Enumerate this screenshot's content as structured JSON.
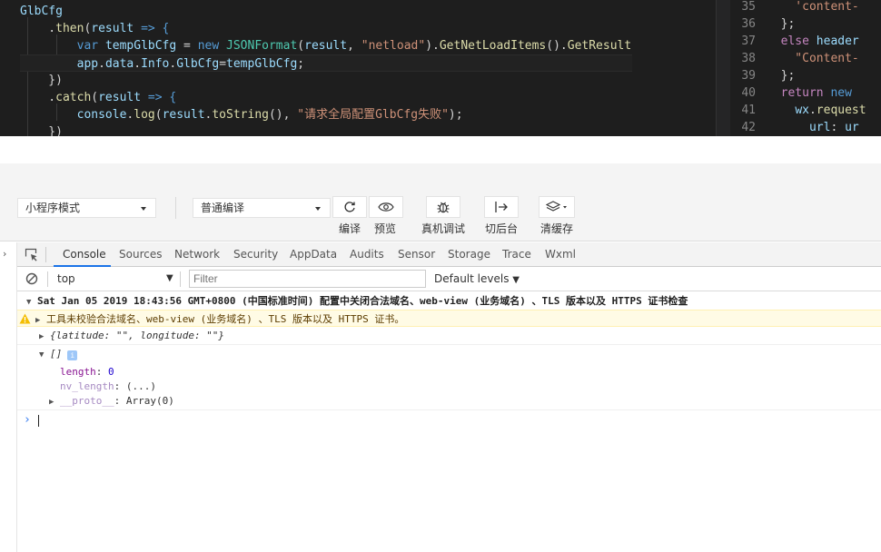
{
  "editor_left": {
    "lines": [
      [
        {
          "t": "GlbCfg",
          "c": "pl9"
        }
      ],
      [
        {
          "t": "    .",
          "c": "plain"
        },
        {
          "t": "then",
          "c": "fn"
        },
        {
          "t": "(",
          "c": "plain"
        },
        {
          "t": "result",
          "c": "var"
        },
        {
          "t": " => {",
          "c": "kw"
        }
      ],
      [
        {
          "t": "        ",
          "c": "plain"
        },
        {
          "t": "var",
          "c": "kw"
        },
        {
          "t": " ",
          "c": "plain"
        },
        {
          "t": "tempGlbCfg",
          "c": "var"
        },
        {
          "t": " = ",
          "c": "plain"
        },
        {
          "t": "new",
          "c": "kw"
        },
        {
          "t": " ",
          "c": "plain"
        },
        {
          "t": "JSONFormat",
          "c": "cls"
        },
        {
          "t": "(",
          "c": "plain"
        },
        {
          "t": "result",
          "c": "var"
        },
        {
          "t": ", ",
          "c": "plain"
        },
        {
          "t": "\"netload\"",
          "c": "str"
        },
        {
          "t": ").",
          "c": "plain"
        },
        {
          "t": "GetNetLoadItems",
          "c": "fn"
        },
        {
          "t": "().",
          "c": "plain"
        },
        {
          "t": "GetResults",
          "c": "fn"
        },
        {
          "t": "(",
          "c": "plain"
        }
      ],
      [
        {
          "t": "        ",
          "c": "plain"
        },
        {
          "t": "app",
          "c": "var"
        },
        {
          "t": ".",
          "c": "plain"
        },
        {
          "t": "data",
          "c": "var"
        },
        {
          "t": ".",
          "c": "plain"
        },
        {
          "t": "Info",
          "c": "var"
        },
        {
          "t": ".",
          "c": "plain"
        },
        {
          "t": "GlbCfg",
          "c": "var"
        },
        {
          "t": "=",
          "c": "plain"
        },
        {
          "t": "tempGlbCfg",
          "c": "var"
        },
        {
          "t": ";",
          "c": "plain"
        }
      ],
      [
        {
          "t": "    })",
          "c": "plain"
        }
      ],
      [
        {
          "t": "    .",
          "c": "plain"
        },
        {
          "t": "catch",
          "c": "fn"
        },
        {
          "t": "(",
          "c": "plain"
        },
        {
          "t": "result",
          "c": "var"
        },
        {
          "t": " => {",
          "c": "kw"
        }
      ],
      [
        {
          "t": "        ",
          "c": "plain"
        },
        {
          "t": "console",
          "c": "var"
        },
        {
          "t": ".",
          "c": "plain"
        },
        {
          "t": "log",
          "c": "fn"
        },
        {
          "t": "(",
          "c": "plain"
        },
        {
          "t": "result",
          "c": "var"
        },
        {
          "t": ".",
          "c": "plain"
        },
        {
          "t": "toString",
          "c": "fn"
        },
        {
          "t": "(), ",
          "c": "plain"
        },
        {
          "t": "\"请求全局配置GlbCfg失败\"",
          "c": "str"
        },
        {
          "t": ");",
          "c": "plain"
        }
      ],
      [
        {
          "t": "    })",
          "c": "plain"
        }
      ]
    ]
  },
  "editor_right": {
    "rows": [
      {
        "num": "35",
        "parts": [
          {
            "t": "    'content-",
            "c": "str"
          }
        ]
      },
      {
        "num": "36",
        "parts": [
          {
            "t": "  };",
            "c": "plain"
          }
        ]
      },
      {
        "num": "37",
        "parts": [
          {
            "t": "  ",
            "c": "plain"
          },
          {
            "t": "else",
            "c": "kw2"
          },
          {
            "t": " header",
            "c": "var"
          }
        ]
      },
      {
        "num": "38",
        "parts": [
          {
            "t": "    \"Content-",
            "c": "str"
          }
        ]
      },
      {
        "num": "39",
        "parts": [
          {
            "t": "  };",
            "c": "plain"
          }
        ]
      },
      {
        "num": "40",
        "parts": [
          {
            "t": "  ",
            "c": "plain"
          },
          {
            "t": "return",
            "c": "kw2"
          },
          {
            "t": " ",
            "c": "plain"
          },
          {
            "t": "new",
            "c": "kw"
          }
        ]
      },
      {
        "num": "41",
        "parts": [
          {
            "t": "    ",
            "c": "plain"
          },
          {
            "t": "wx",
            "c": "var"
          },
          {
            "t": ".",
            "c": "plain"
          },
          {
            "t": "request",
            "c": "fn"
          }
        ]
      },
      {
        "num": "42",
        "parts": [
          {
            "t": "      ",
            "c": "plain"
          },
          {
            "t": "url",
            "c": "var"
          },
          {
            "t": ": ",
            "c": "plain"
          },
          {
            "t": "ur",
            "c": "var"
          }
        ]
      }
    ]
  },
  "toolbar": {
    "mode_select": "小程序模式",
    "compile_select": "普通编译",
    "buttons": [
      {
        "label": "编译",
        "icon": "refresh-icon"
      },
      {
        "label": "预览",
        "icon": "eye-icon"
      },
      {
        "label": "真机调试",
        "icon": "bug-icon"
      },
      {
        "label": "切后台",
        "icon": "switch-background-icon"
      },
      {
        "label": "清缓存",
        "icon": "layers-icon"
      }
    ]
  },
  "devtools": {
    "tabs": [
      "Console",
      "Sources",
      "Network",
      "Security",
      "AppData",
      "Audits",
      "Sensor",
      "Storage",
      "Trace",
      "Wxml"
    ],
    "active_tab": "Console",
    "context": "top",
    "filter_placeholder": "Filter",
    "levels": "Default levels",
    "console": {
      "group_header": "Sat Jan 05 2019 18:43:56 GMT+0800 (中国标准时间) 配置中关闭合法域名、web-view (业务域名) 、TLS 版本以及 HTTPS 证书检查",
      "warning": "工具未校验合法域名、web-view (业务域名) 、TLS 版本以及 HTTPS 证书。",
      "object_line": "{latitude: \"\", longitude: \"\"}",
      "array_line": "[]",
      "info_badge": "i",
      "props": [
        {
          "key": "length",
          "value": "0"
        },
        {
          "key": "nv_length",
          "value": "(...)"
        },
        {
          "key": "__proto__",
          "value": "Array(0)"
        }
      ]
    }
  }
}
